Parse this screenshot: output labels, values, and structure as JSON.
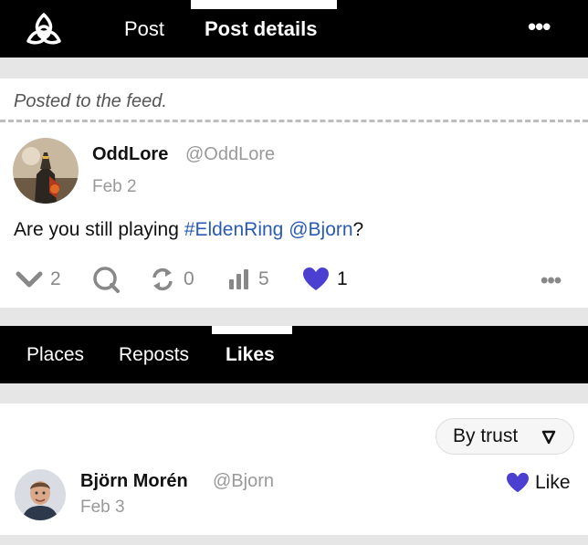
{
  "header": {
    "logo_icon": "triquetra-logo-icon",
    "tabs": [
      {
        "label": "Post"
      },
      {
        "label": "Post details"
      }
    ],
    "active_tab": "Post details",
    "menu_label": "•••"
  },
  "notice": {
    "text": "Posted to the feed."
  },
  "post": {
    "author_name": "OddLore",
    "author_handle": "@OddLore",
    "date": "Feb 2",
    "text_before": "Are you still playing ",
    "hashtag": "#EldenRing",
    "mention": "@Bjorn",
    "text_after": "?",
    "actions": {
      "upvotes": "2",
      "reposts": "0",
      "views": "5",
      "likes": "1",
      "more_label": "•••"
    }
  },
  "subtabs": {
    "items": [
      {
        "label": "Places"
      },
      {
        "label": "Reposts"
      },
      {
        "label": "Likes"
      }
    ],
    "active": "Likes"
  },
  "likes": {
    "sort_label": "By trust",
    "sort_icon": "▽",
    "liker": {
      "name": "Björn Morén",
      "handle": "@Bjorn",
      "date": "Feb 3",
      "like_label": "Like"
    }
  },
  "colors": {
    "accent_purple": "#4b3fd1",
    "link_blue": "#2a5ab3",
    "bar_black": "#000000"
  }
}
